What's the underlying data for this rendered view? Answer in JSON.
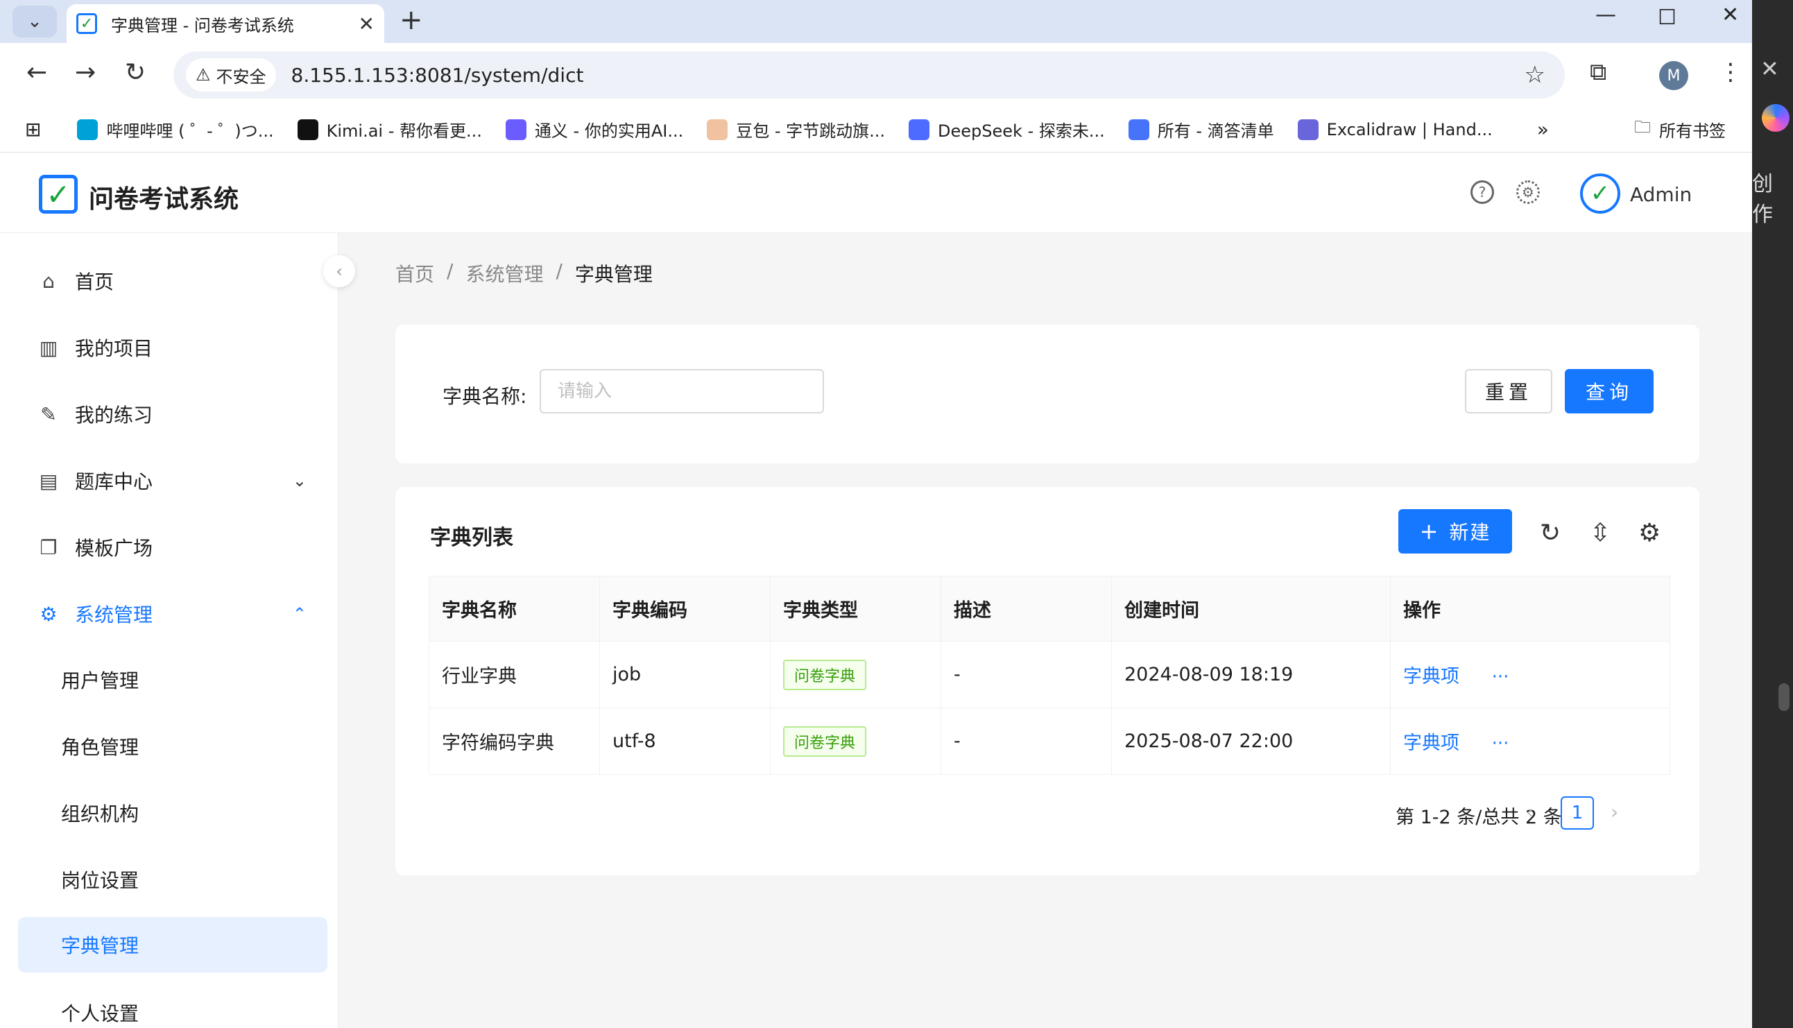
{
  "browser": {
    "tab_title": "字典管理 - 问卷考试系统",
    "insecure_label": "不安全",
    "url": "8.155.1.153:8081/system/dict",
    "profile_initial": "M",
    "bookmarks": [
      {
        "label": "哔哩哔哩 ( ゜- ゜)つ...",
        "icon": "bilibili-icon",
        "color": "#00a1d6"
      },
      {
        "label": "Kimi.ai - 帮你看更...",
        "icon": "kimi-icon",
        "color": "#111111"
      },
      {
        "label": "通义 - 你的实用AI...",
        "icon": "tongyi-icon",
        "color": "#6a5cff"
      },
      {
        "label": "豆包 - 字节跳动旗...",
        "icon": "doubao-icon",
        "color": "#f0c2a0"
      },
      {
        "label": "DeepSeek - 探索未...",
        "icon": "deepseek-icon",
        "color": "#4d6bfe"
      },
      {
        "label": "所有 - 滴答清单",
        "icon": "ticktick-icon",
        "color": "#4772fa"
      },
      {
        "label": "Excalidraw | Hand...",
        "icon": "excalidraw-icon",
        "color": "#6965db"
      }
    ],
    "all_bookmarks": "所有书签",
    "side_text": "创作"
  },
  "app": {
    "title": "问卷考试系统",
    "user": "Admin"
  },
  "sidebar": {
    "items": [
      {
        "label": "首页",
        "icon": "home-icon"
      },
      {
        "label": "我的项目",
        "icon": "project-icon"
      },
      {
        "label": "我的练习",
        "icon": "edit-icon"
      },
      {
        "label": "题库中心",
        "icon": "database-icon"
      },
      {
        "label": "模板广场",
        "icon": "template-icon"
      },
      {
        "label": "系统管理",
        "icon": "settings-icon"
      }
    ],
    "sub_items": [
      "用户管理",
      "角色管理",
      "组织机构",
      "岗位设置",
      "字典管理",
      "个人设置"
    ]
  },
  "breadcrumb": [
    "首页",
    "/",
    "系统管理",
    "/",
    "字典管理"
  ],
  "search": {
    "label": "字典名称:",
    "placeholder": "请输入",
    "reset": "重置",
    "query": "查询"
  },
  "list": {
    "title": "字典列表",
    "new_button": "新建",
    "columns": [
      "字典名称",
      "字典编码",
      "字典类型",
      "描述",
      "创建时间",
      "操作"
    ],
    "rows": [
      {
        "name": "行业字典",
        "code": "job",
        "type": "问卷字典",
        "desc": "-",
        "created": "2024-08-09 18:19",
        "action": "字典项",
        "more": "···"
      },
      {
        "name": "字符编码字典",
        "code": "utf-8",
        "type": "问卷字典",
        "desc": "-",
        "created": "2025-08-07 22:00",
        "action": "字典项",
        "more": "···"
      }
    ],
    "pagination_text": "第 1-2 条/总共 2 条",
    "current_page": "1"
  }
}
